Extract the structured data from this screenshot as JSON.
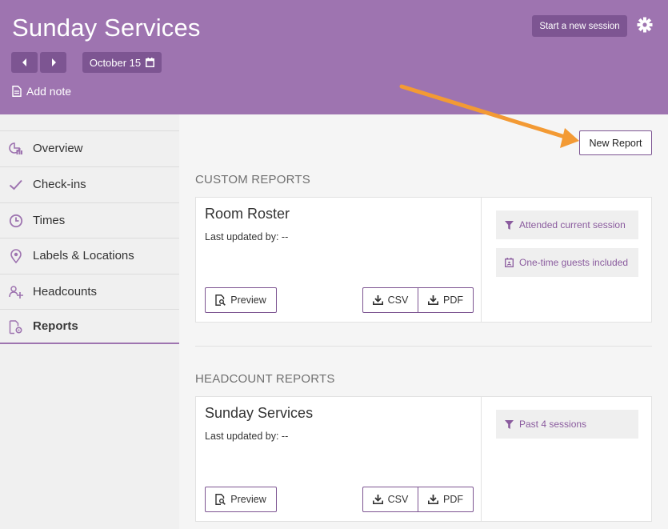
{
  "header": {
    "title": "Sunday Services",
    "date_label": "October 15",
    "add_note_label": "Add note",
    "start_session_label": "Start a new session"
  },
  "sidebar": {
    "items": [
      {
        "label": "Overview",
        "icon": "chart-pie-icon",
        "active": false
      },
      {
        "label": "Check-ins",
        "icon": "check-icon",
        "active": false
      },
      {
        "label": "Times",
        "icon": "clock-icon",
        "active": false
      },
      {
        "label": "Labels & Locations",
        "icon": "map-pin-icon",
        "active": false
      },
      {
        "label": "Headcounts",
        "icon": "users-icon",
        "active": false
      },
      {
        "label": "Reports",
        "icon": "report-settings-icon",
        "active": true
      }
    ]
  },
  "main": {
    "new_report_label": "New Report",
    "custom_reports": {
      "title": "CUSTOM REPORTS",
      "card": {
        "name": "Room Roster",
        "updated": "Last updated by: --",
        "preview_label": "Preview",
        "csv_label": "CSV",
        "pdf_label": "PDF",
        "tags": [
          "Attended current session",
          "One-time guests included"
        ]
      }
    },
    "headcount_reports": {
      "title": "HEADCOUNT REPORTS",
      "card": {
        "name": "Sunday Services",
        "updated": "Last updated by: --",
        "preview_label": "Preview",
        "csv_label": "CSV",
        "pdf_label": "PDF",
        "tags": [
          "Past 4 sessions"
        ]
      }
    }
  },
  "colors": {
    "header": "#9e74b0",
    "accent_dark": "#7d5592",
    "tag_text": "#8a5b9e",
    "arrow": "#f39a34"
  }
}
